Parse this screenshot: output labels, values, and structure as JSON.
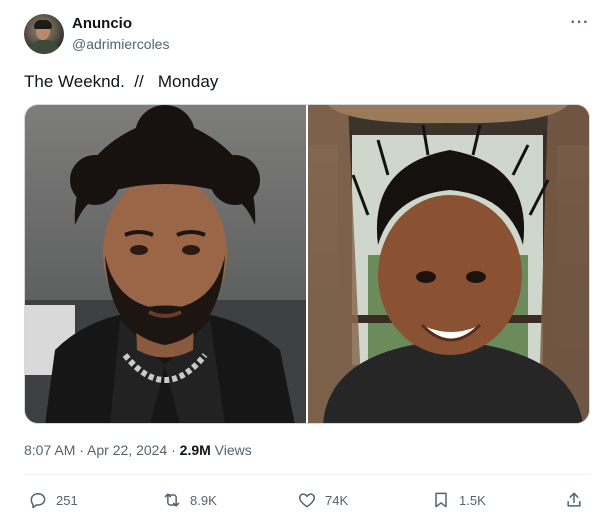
{
  "author": {
    "name": "Anuncio",
    "handle": "@adrimiercoles"
  },
  "more_icon": "ellipsis-icon",
  "tweet_text": "The Weeknd.  //   Monday",
  "media": {
    "images": [
      "photo-left",
      "photo-right"
    ]
  },
  "meta": {
    "time": "8:07 AM",
    "separator1": " · ",
    "date": "Apr 22, 2024",
    "separator2": " · ",
    "views_count": "2.9M",
    "views_label": " Views"
  },
  "actions": {
    "reply": {
      "icon": "reply-icon",
      "count": "251"
    },
    "repost": {
      "icon": "repost-icon",
      "count": "8.9K"
    },
    "like": {
      "icon": "heart-icon",
      "count": "74K"
    },
    "bookmark": {
      "icon": "bookmark-icon",
      "count": "1.5K"
    },
    "share": {
      "icon": "share-icon"
    }
  },
  "colors": {
    "text_primary": "#0f1419",
    "text_secondary": "#536471",
    "border": "#cfd9de"
  }
}
